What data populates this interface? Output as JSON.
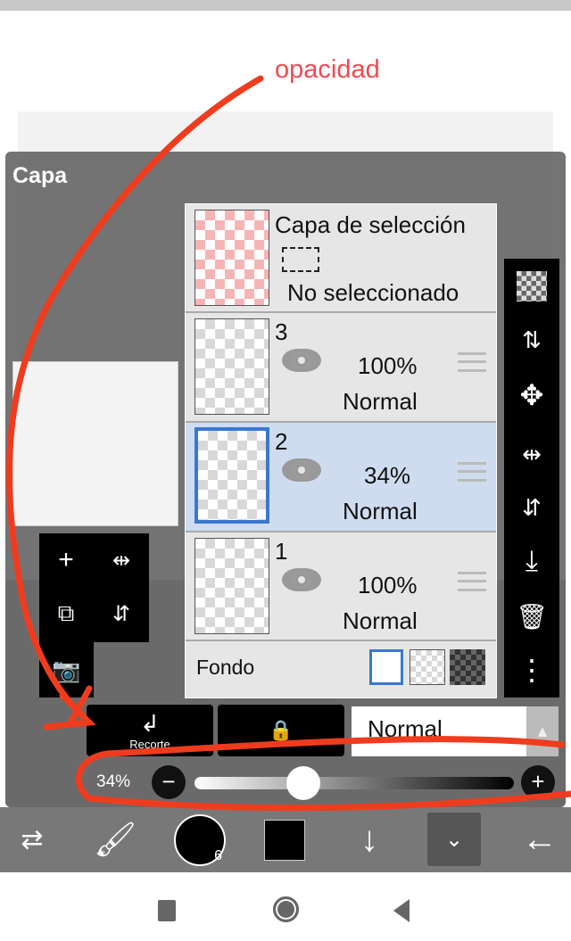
{
  "annotation": {
    "label": "opacidad",
    "color": "#f03c1e"
  },
  "panel": {
    "title": "Capa"
  },
  "selection_layer": {
    "title": "Capa de selección",
    "status": "No seleccionado"
  },
  "layers": [
    {
      "name": "3",
      "opacity": "100%",
      "blend": "Normal",
      "selected": false
    },
    {
      "name": "2",
      "opacity": "34%",
      "blend": "Normal",
      "selected": true
    },
    {
      "name": "1",
      "opacity": "100%",
      "blend": "Normal",
      "selected": false
    }
  ],
  "background": {
    "label": "Fondo"
  },
  "buttons": {
    "clip": "Recorte"
  },
  "blend_mode": {
    "value": "Normal"
  },
  "opacity": {
    "value": "34%",
    "fraction": 0.34
  },
  "brush": {
    "size": "6"
  },
  "colors": {
    "accent": "#3a78d0",
    "selected_row": "#cfdcef"
  }
}
